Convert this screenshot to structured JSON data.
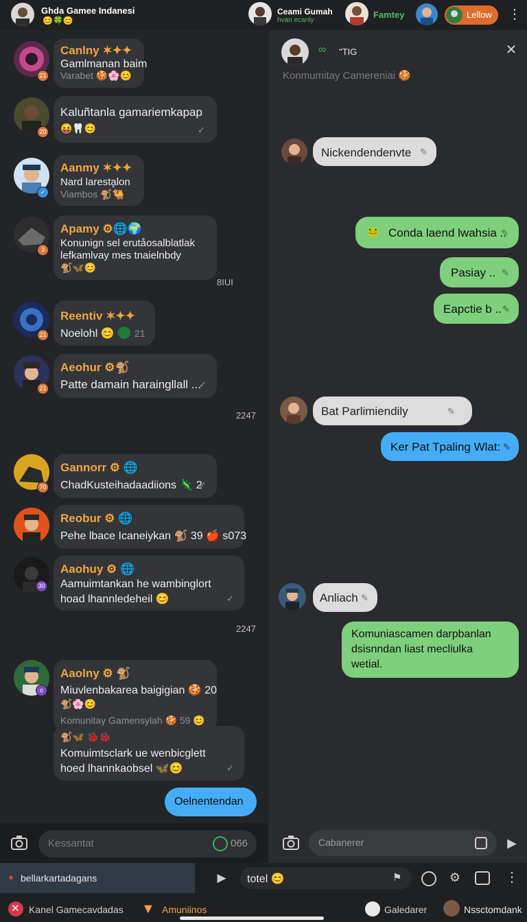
{
  "header": {
    "title": "Ghda Gamee Indanesi",
    "title_emojis": "😊🍀😊",
    "contact_name": "Ceami Gumah",
    "contact_sub": "hvan ecanly",
    "tag_fantasy": "Famtey",
    "follow_label": "Lellow",
    "menu_icon": "more-vertical-icon"
  },
  "left_messages": [
    {
      "name": "Canlny ✶✦✦",
      "line1": "Gamlmanan baim",
      "line2": "Varabet 🍪🌸😊",
      "badge": "21"
    },
    {
      "name": "",
      "line1": "Kaluñtanla gamariemkapap",
      "line2": "😝🦷😊",
      "badge": "20"
    },
    {
      "name": "Aanmy ✶✦✦",
      "line1": "Nard laresta̧lon",
      "line2": "Viambos  🐒🐫",
      "badge": ""
    },
    {
      "name": "Apamy ⚙🌐🌍",
      "line1": "Konunign sel erutåosalblatlak",
      "line2": "lefkamlvay mes tnaielnbdy",
      "line3": "🐒🦋😊",
      "badge": "3"
    },
    {
      "name": "Reentiv ✶✦✦",
      "line1": "Noelohl 😊",
      "line2": "21",
      "badge": "21"
    },
    {
      "name": "Aeohur ⚙🐒",
      "line1": "Patte damain haraingllall ...",
      "badge": "21"
    },
    {
      "name": "Gannorr ⚙ 🌐",
      "line1": "ChadKusteihadaadiions 🦎 2",
      "badge": "70"
    },
    {
      "name": "Reobur ⚙ 🌐",
      "line1": "Pehe lbace Icaneiykan 🐒 39 🍎 s073",
      "badge": ""
    },
    {
      "name": "Aaohuy ⚙ 🌐",
      "line1": "Aamuimtankan he wambinglort",
      "line2": "hoad lhannledeheil 😊",
      "badge": "30"
    },
    {
      "name": "Aaolny ⚙ 🐒",
      "line1": "Miuvlenbakarea baigigian 🍪 20",
      "line2": "🐒🌸😊",
      "line3": "Komunitay Gamensylah 🍪 59 😊",
      "line4": "🐒🦋 🐞🐞",
      "line5": "Komuimtsclark ue wenbicglett",
      "line6": "hoed lhannkaobsel 🦋😊",
      "badge": "o"
    }
  ],
  "left_times": [
    "8IUI",
    "2247",
    "2247"
  ],
  "left_last_sent": "Oelnentendan",
  "left_composer": {
    "placeholder": "Kessantat",
    "count": "066"
  },
  "right_header": {
    "tag": "\"TIG",
    "subtitle": "Konmumitay Camereniai 🍪"
  },
  "right_messages": [
    {
      "side": "in",
      "text": "Nickendendenvte",
      "style": "grey"
    },
    {
      "side": "out",
      "text": "Conda laend lwahsia ..",
      "style": "green"
    },
    {
      "side": "out",
      "text": "Pasiay ..",
      "style": "green"
    },
    {
      "side": "out",
      "text": "Eapctie b ..",
      "style": "green"
    },
    {
      "side": "in",
      "text": "Bat Parlimiendily",
      "style": "grey"
    },
    {
      "side": "out",
      "text": "Ker Pat Tpaling Wlat:",
      "style": "blue"
    },
    {
      "side": "in",
      "text": "Anliach",
      "style": "grey"
    },
    {
      "side": "out",
      "line1": "Komuniascamen darpbanlan",
      "line2": "dsisnndan liast mecliulka",
      "line3": "wetial.",
      "style": "green"
    }
  ],
  "right_composer": {
    "placeholder": "Cabanerer"
  },
  "bottom_bar": {
    "status_text": "bellarkartadagans",
    "input_value": "totel 😊",
    "nav1": "Kanel Gamecavdadas",
    "nav2": "Amuniinos",
    "nav3": "Galedarer",
    "nav4": "Nssctomdank"
  },
  "colors": {
    "accent_orange": "#f0a640",
    "green_bubble": "#7ed07d",
    "blue_bubble": "#45adf7"
  }
}
